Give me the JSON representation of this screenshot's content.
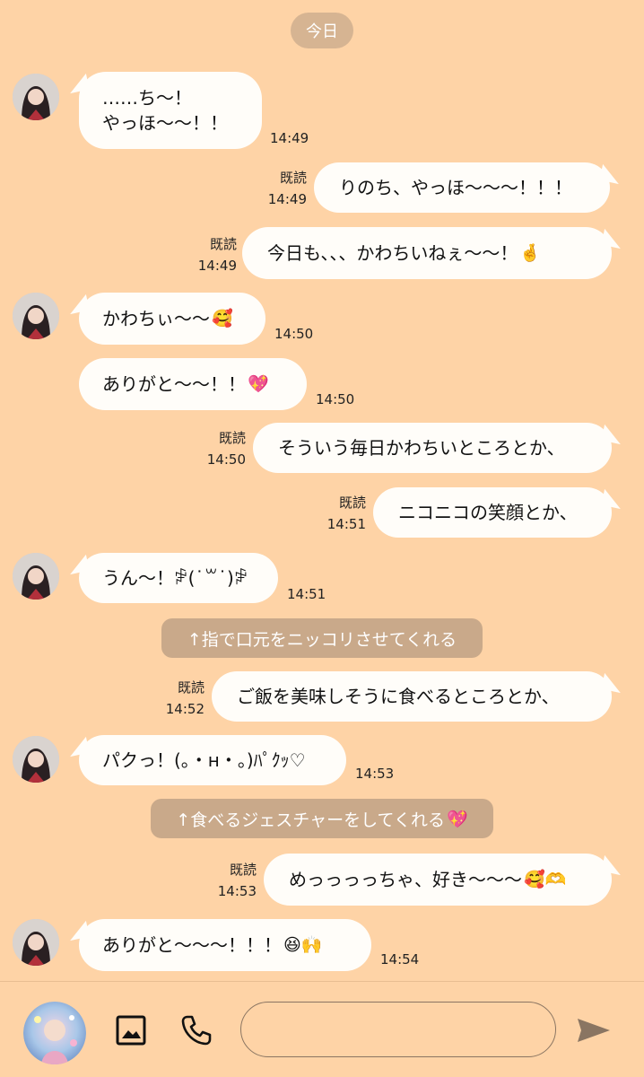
{
  "date_label": "今日",
  "read_label": "既読",
  "messages": [
    {
      "side": "left",
      "lines": [
        "……ち〜！",
        "やっほ〜〜！！"
      ],
      "time": "14:49"
    },
    {
      "side": "right",
      "text": "りのち、やっほ〜〜〜！！！",
      "time": "14:49",
      "read": true
    },
    {
      "side": "right",
      "text": "今日も、、、かわちいねぇ〜〜！",
      "emoji": "🤞",
      "time": "14:49",
      "read": true
    },
    {
      "side": "left",
      "text": "かわちぃ〜〜",
      "emoji": "🥰",
      "time": "14:50"
    },
    {
      "side": "left",
      "text": "ありがと〜〜！！",
      "emoji": "💖",
      "time": "14:50"
    },
    {
      "side": "right",
      "text": "そういう毎日かわちいところとか、",
      "time": "14:50",
      "read": true
    },
    {
      "side": "right",
      "text": "ニコニコの笑顔とか、",
      "time": "14:51",
      "read": true
    },
    {
      "side": "left",
      "text": "うん〜！ꒁ(˙꒳˙)ꒁ",
      "time": "14:51"
    },
    {
      "side": "right",
      "text": "ご飯を美味しそうに食べるところとか、",
      "time": "14:52",
      "read": true
    },
    {
      "side": "left",
      "text": "パクっ！(。・н・。)ﾊﾟｸｯ♡",
      "time": "14:53"
    },
    {
      "side": "right",
      "text": "めっっっっちゃ、好き〜〜〜",
      "emoji": "🥰🫶",
      "time": "14:53",
      "read": true
    },
    {
      "side": "left",
      "text": "ありがと〜〜〜！！！",
      "emoji": "😆🙌",
      "time": "14:54"
    }
  ],
  "notes": [
    {
      "text": "↑指で口元をニッコリさせてくれる"
    },
    {
      "text": "↑食べるジェスチャーをしてくれる",
      "emoji": "💖"
    }
  ],
  "composer": {
    "placeholder": "",
    "image_icon": "image-icon",
    "call_icon": "phone-icon",
    "send_icon": "send-icon"
  },
  "colors": {
    "background": "#FED3A6",
    "bubble": "#FFFDF9",
    "date_pill": "#D6B492",
    "note": "#C9A98A"
  }
}
